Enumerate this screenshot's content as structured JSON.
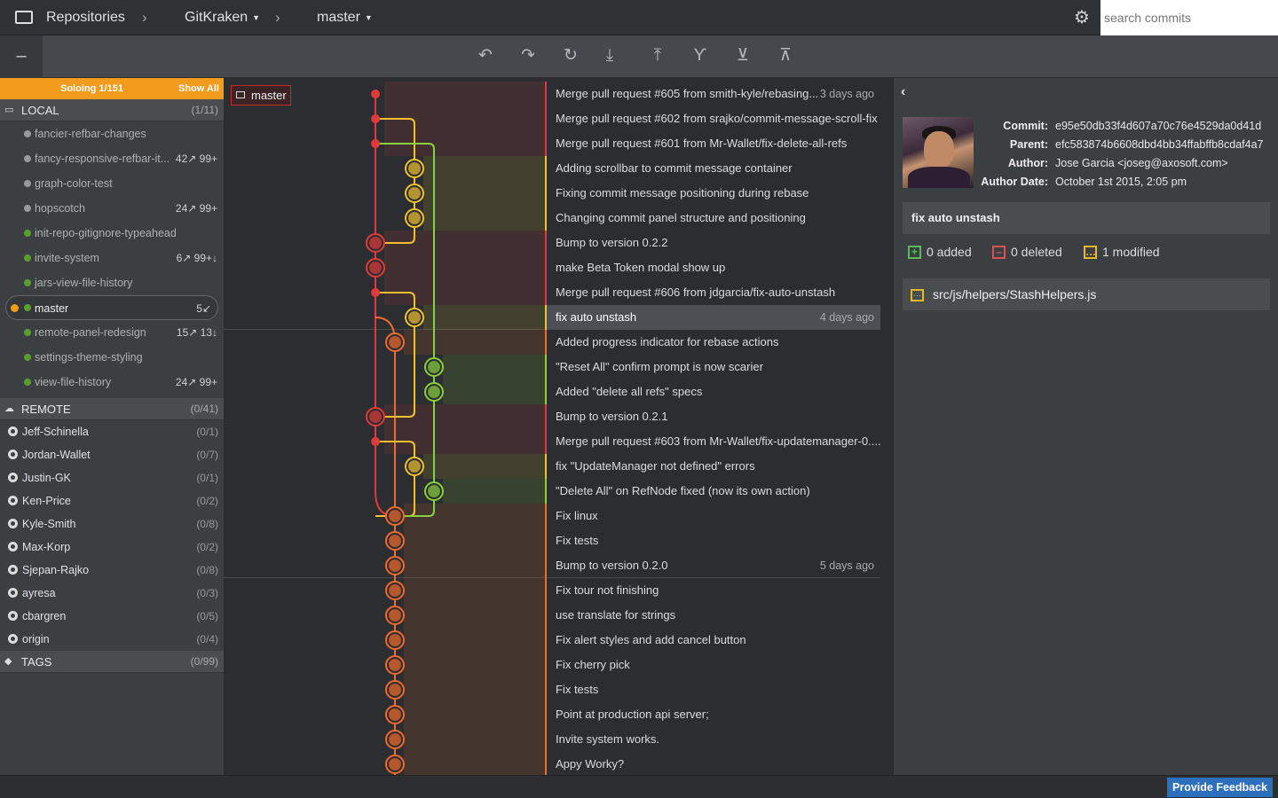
{
  "header": {
    "repositories": "Repositories",
    "repo": "GitKraken",
    "branch": "master",
    "search_placeholder": "search commits"
  },
  "toolbar": {
    "collapse": "–",
    "buttons": [
      {
        "name": "undo-icon",
        "glyph": "↶"
      },
      {
        "name": "redo-icon",
        "glyph": "↷"
      },
      {
        "name": "refresh-icon",
        "glyph": "↻"
      },
      {
        "name": "pull-icon",
        "glyph": "⤓"
      },
      {
        "name": "push-icon",
        "glyph": "⤒"
      },
      {
        "name": "branch-icon",
        "glyph": "Ƴ"
      },
      {
        "name": "stash-icon",
        "glyph": "⊻"
      },
      {
        "name": "pop-icon",
        "glyph": "⊼"
      }
    ]
  },
  "sidebar": {
    "solo_label": "Soloing 1/151",
    "show_all": "Show All",
    "local": {
      "label": "LOCAL",
      "count": "(1/11)"
    },
    "branches": [
      {
        "name": "fancier-refbar-changes",
        "stat": "",
        "color": "#999"
      },
      {
        "name": "fancy-responsive-refbar-it...",
        "stat": "42↗ 99+",
        "color": "#999"
      },
      {
        "name": "graph-color-test",
        "stat": "",
        "color": "#999"
      },
      {
        "name": "hopscotch",
        "stat": "24↗ 99+",
        "color": "#999"
      },
      {
        "name": "init-repo-gitignore-typeahead",
        "stat": "",
        "color": "#5c9e2e"
      },
      {
        "name": "invite-system",
        "stat": "6↗ 99+↓",
        "color": "#5c9e2e"
      },
      {
        "name": "jars-view-file-history",
        "stat": "",
        "color": "#5c9e2e"
      },
      {
        "name": "master",
        "stat": "5↙",
        "color": "#5c9e2e",
        "active": true
      },
      {
        "name": "remote-panel-redesign",
        "stat": "15↗ 13↓",
        "color": "#5c9e2e"
      },
      {
        "name": "settings-theme-styling",
        "stat": "",
        "color": "#5c9e2e"
      },
      {
        "name": "view-file-history",
        "stat": "24↗ 99+",
        "color": "#5c9e2e"
      }
    ],
    "remote": {
      "label": "REMOTE",
      "count": "(0/41)"
    },
    "remotes": [
      {
        "name": "Jeff-Schinella",
        "count": "(0/1)"
      },
      {
        "name": "Jordan-Wallet",
        "count": "(0/7)"
      },
      {
        "name": "Justin-GK",
        "count": "(0/1)"
      },
      {
        "name": "Ken-Price",
        "count": "(0/2)"
      },
      {
        "name": "Kyle-Smith",
        "count": "(0/8)"
      },
      {
        "name": "Max-Korp",
        "count": "(0/2)"
      },
      {
        "name": "Sjepan-Rajko",
        "count": "(0/8)"
      },
      {
        "name": "ayresa",
        "count": "(0/3)"
      },
      {
        "name": "cbargren",
        "count": "(0/5)"
      },
      {
        "name": "origin",
        "count": "(0/4)"
      }
    ],
    "tags": {
      "label": "TAGS",
      "count": "(0/99)"
    }
  },
  "graph": {
    "branch_tag": "master",
    "commits": [
      {
        "msg": "Merge pull request #605 from smith-kyle/rebasing...",
        "time": "3 days ago",
        "lane": 0,
        "merge": true
      },
      {
        "msg": "Merge pull request #602 from srajko/commit-message-scroll-fix",
        "time": "",
        "lane": 0,
        "merge": true
      },
      {
        "msg": "Merge pull request #601 from Mr-Wallet/fix-delete-all-refs",
        "time": "",
        "lane": 0,
        "merge": true
      },
      {
        "msg": "Adding scrollbar to commit message container",
        "time": "",
        "lane": 2
      },
      {
        "msg": "Fixing commit message positioning during rebase",
        "time": "",
        "lane": 2
      },
      {
        "msg": "Changing commit panel structure and positioning",
        "time": "",
        "lane": 2
      },
      {
        "msg": "Bump to version 0.2.2",
        "time": "",
        "lane": 0
      },
      {
        "msg": "make Beta Token modal show up",
        "time": "",
        "lane": 0
      },
      {
        "msg": "Merge pull request #606 from jdgarcia/fix-auto-unstash",
        "time": "",
        "lane": 0,
        "merge": true
      },
      {
        "msg": "fix auto unstash",
        "time": "4 days ago",
        "lane": 2,
        "selected": true,
        "sep": true
      },
      {
        "msg": "Added progress indicator for rebase actions",
        "time": "",
        "lane": 1
      },
      {
        "msg": "\"Reset All\" confirm prompt is now scarier",
        "time": "",
        "lane": 3
      },
      {
        "msg": "Added \"delete all refs\" specs",
        "time": "",
        "lane": 3
      },
      {
        "msg": "Bump to version 0.2.1",
        "time": "",
        "lane": 0
      },
      {
        "msg": "Merge pull request #603 from Mr-Wallet/fix-updatemanager-0....",
        "time": "",
        "lane": 0,
        "merge": true
      },
      {
        "msg": "fix \"UpdateManager not defined\" errors",
        "time": "",
        "lane": 2
      },
      {
        "msg": "\"Delete All\" on RefNode fixed (now its own action)",
        "time": "",
        "lane": 3
      },
      {
        "msg": "Fix linux",
        "time": "",
        "lane": 1
      },
      {
        "msg": "Fix tests",
        "time": "",
        "lane": 1
      },
      {
        "msg": "Bump to version 0.2.0",
        "time": "5 days ago",
        "lane": 1,
        "sep": true
      },
      {
        "msg": "Fix tour not finishing",
        "time": "",
        "lane": 1
      },
      {
        "msg": "use translate for strings",
        "time": "",
        "lane": 1
      },
      {
        "msg": "Fix alert styles and add cancel button",
        "time": "",
        "lane": 1
      },
      {
        "msg": "Fix cherry pick",
        "time": "",
        "lane": 1
      },
      {
        "msg": "Fix tests",
        "time": "",
        "lane": 1
      },
      {
        "msg": "Point at production api server;",
        "time": "",
        "lane": 1
      },
      {
        "msg": "Invite system works.",
        "time": "",
        "lane": 1
      },
      {
        "msg": "Appy Worky?",
        "time": "",
        "lane": 1
      }
    ]
  },
  "detail": {
    "commit_label": "Commit:",
    "commit": "e95e50db33f4d607a70c76e4529da0d41d",
    "parent_label": "Parent:",
    "parent": "efc583874b6608dbd4bb34ffabffb8cdaf4a7",
    "author_label": "Author:",
    "author": "Jose Garcia <joseg@axosoft.com>",
    "date_label": "Author Date:",
    "date": "October 1st 2015, 2:05 pm",
    "summary": "fix auto unstash",
    "added": "0 added",
    "deleted": "0 deleted",
    "modified": "1 modified",
    "file": "src/js/helpers/StashHelpers.js"
  },
  "footer": {
    "feedback": "Provide Feedback"
  },
  "colors": {
    "lane0": "#e03a3a",
    "lane1": "#f06a2c",
    "lane2": "#f0c030",
    "lane3": "#8ad03c",
    "solo": "#f29b1d"
  }
}
